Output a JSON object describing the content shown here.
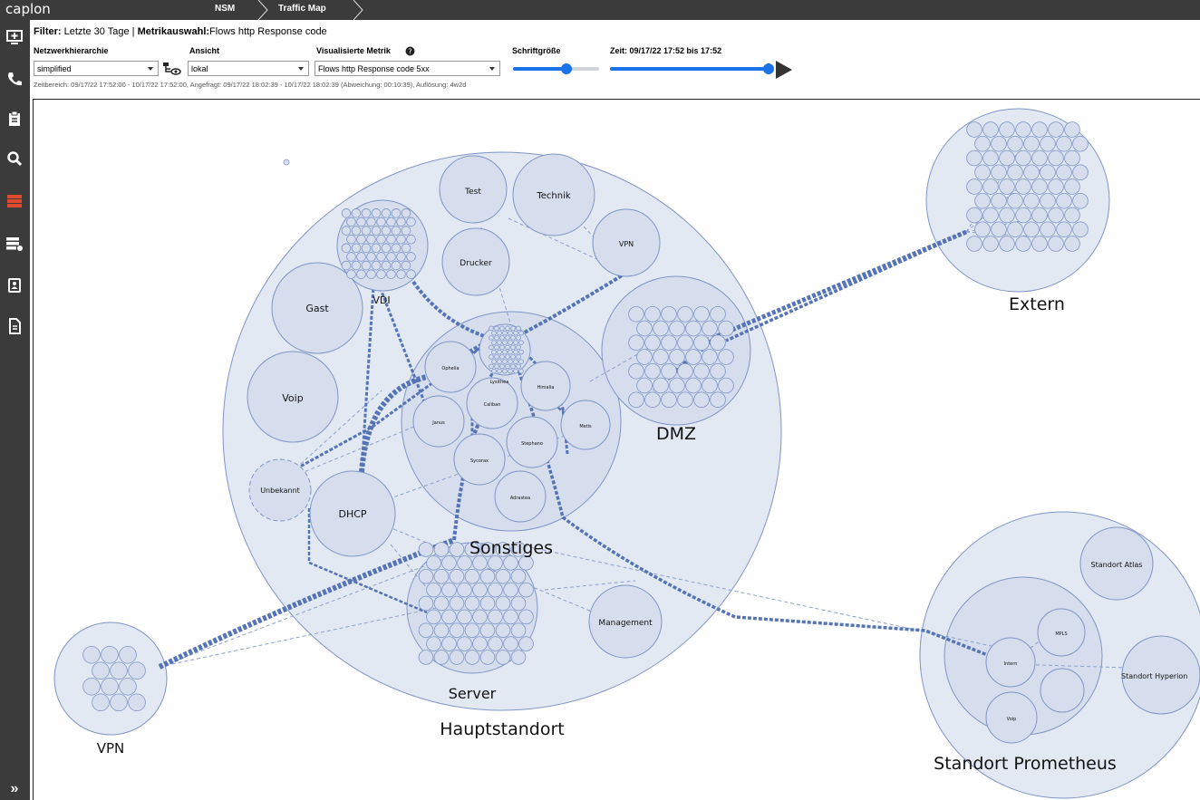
{
  "app": {
    "brand": "caplon"
  },
  "breadcrumb": {
    "items": [
      "NSM",
      "Traffic Map"
    ]
  },
  "sidebar": {
    "icons": [
      "monitor-plus-icon",
      "phone-icon",
      "clipboard-icon",
      "search-icon",
      "server-stack-icon",
      "server-settings-icon",
      "contact-card-icon",
      "document-icon"
    ],
    "expand_label": "»"
  },
  "filter": {
    "label": "Filter:",
    "period": "Letzte 30 Tage",
    "separator": "|",
    "metric_label": "Metrikauswahl:",
    "metric": "Flows http Response code"
  },
  "controls": {
    "hierarchy": {
      "label": "Netzwerkhierarchie",
      "value": "simplified"
    },
    "view": {
      "label": "Ansicht",
      "value": "lokal"
    },
    "metric": {
      "label": "Visualisierte Metrik",
      "value": "Flows http Response code 5xx"
    },
    "font_size": {
      "label": "Schriftgröße",
      "level": 0.62
    },
    "time": {
      "label": "Zeit: 09/17/22 17:52 bis 17:52",
      "level": 1.0
    }
  },
  "info": "Zeitbereich: 09/17/22 17:52:00 - 10/17/22 17:52:00, Angefragt: 09/17/22 18:02:39 - 10/17/22 18:02:39 (Abweichung: 00:10:39), Auflösung: 4w2d",
  "map": {
    "zones": {
      "hauptstandort": "Hauptstandort",
      "sonstiges": "Sonstiges",
      "dmz": "DMZ",
      "server": "Server",
      "extern": "Extern",
      "vpn_outer": "VPN",
      "prometheus": "Standort Prometheus"
    },
    "nodes": {
      "test": "Test",
      "technik": "Technik",
      "vpn": "VPN",
      "drucker": "Drucker",
      "vdi": "VDI",
      "gast": "Gast",
      "voip": "Voip",
      "unbekannt": "Unbekannt",
      "dhcp": "DHCP",
      "management": "Management",
      "ophelia": "Ophelia",
      "lysithea": "Lysithea",
      "himalia": "Himalia",
      "caliban": "Caliban",
      "janus": "Janus",
      "metis": "Metis",
      "stephano": "Stephano",
      "sycorax": "Sycorax",
      "adrastea": "Adrastea",
      "atlas": "Standort Atlas",
      "hyperion": "Standort Hyperion",
      "intern": "Intern",
      "mpls": "MPLS",
      "voip2": "Voip"
    },
    "colors": {
      "fill": "#dbe3f0",
      "stroke": "#7b93c4",
      "flow": "#5574b5"
    }
  }
}
